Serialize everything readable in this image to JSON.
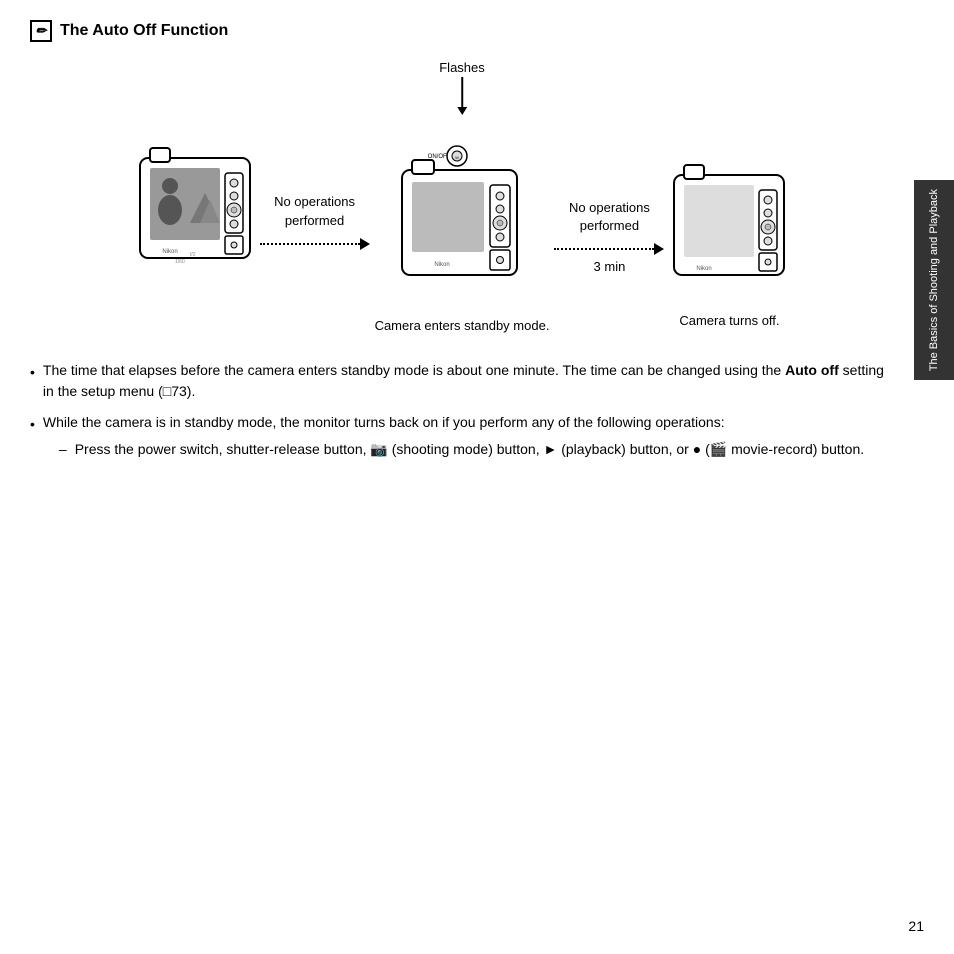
{
  "title": "The Auto Off Function",
  "diagram": {
    "flashes_label": "Flashes",
    "camera1_label": "",
    "no_ops_label_1": "No operations\nperformed",
    "standby_label": "Camera enters standby mode.",
    "no_ops_label_2": "No operations\nperformed",
    "time_label": "3 min",
    "turns_off_label": "Camera turns off.",
    "arrow_dots": "· · · · · · · · ·"
  },
  "bullets": [
    {
      "text": "The time that elapses before the camera enters standby mode is about one minute. The time can be changed using the ",
      "bold_text": "Auto off",
      "text2": " setting in the setup menu (□73)."
    },
    {
      "text": "While the camera is in standby mode, the monitor turns back on if you perform any of the following operations:"
    }
  ],
  "sub_bullets": [
    {
      "text": "Press the power switch, shutter-release button, 📷 (shooting mode) button, ▶ (playback) button, or ● (🎬 movie-record) button."
    }
  ],
  "side_tab": "The Basics of Shooting and Playback",
  "page_number": "21"
}
